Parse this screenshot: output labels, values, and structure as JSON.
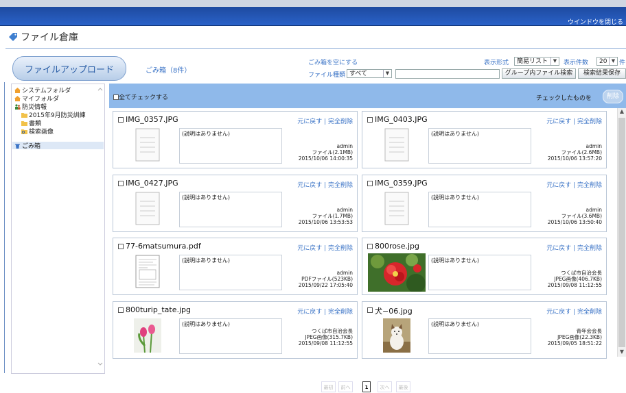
{
  "window": {
    "close_label": "ウインドウを閉じる"
  },
  "header": {
    "title": "ファイル倉庫"
  },
  "toolbar": {
    "upload_label": "ファイルアップロード",
    "trash_label": "ごみ箱（8件）",
    "empty_trash_label": "ごみ箱を空にする",
    "file_type_label": "ファイル種類",
    "file_type_value": "すべて",
    "display_format_label": "表示形式",
    "display_format_value": "簡易リスト",
    "display_count_label": "表示件数",
    "display_count_value": "20",
    "display_count_unit": "件",
    "search_input_value": "",
    "group_search_label": "グループ内ファイル検索",
    "save_results_label": "検索結果保存"
  },
  "sidebar": {
    "items": [
      {
        "label": "システムフォルダ",
        "icon": "home-folder-icon"
      },
      {
        "label": "マイフォルダ",
        "icon": "home-folder-icon"
      },
      {
        "label": "防災情報",
        "icon": "group-icon"
      },
      {
        "label": "2015年9月防災訓練",
        "icon": "folder-icon"
      },
      {
        "label": "書類",
        "icon": "folder-icon"
      },
      {
        "label": "検索画像",
        "icon": "search-folder-icon"
      },
      {
        "label": "ごみ箱",
        "icon": "trash-icon"
      }
    ]
  },
  "checkbar": {
    "check_all_label": "全てチェックする",
    "checked_action_label": "チェックしたものを",
    "delete_label": "削除"
  },
  "actions": {
    "restore": "元に戻す",
    "separator": " | ",
    "delete": "完全削除"
  },
  "files": [
    {
      "name": "IMG_0357.JPG",
      "desc": "(説明はありません)",
      "owner": "admin",
      "type": "ファイル(2.1MB)",
      "date": "2015/10/06 14:00:35",
      "thumb": "document-icon"
    },
    {
      "name": "IMG_0403.JPG",
      "desc": "(説明はありません)",
      "owner": "admin",
      "type": "ファイル(2.6MB)",
      "date": "2015/10/06 13:57:20",
      "thumb": "document-icon"
    },
    {
      "name": "IMG_0427.JPG",
      "desc": "(説明はありません)",
      "owner": "admin",
      "type": "ファイル(1.7MB)",
      "date": "2015/10/06 13:53:53",
      "thumb": "document-icon"
    },
    {
      "name": "IMG_0359.JPG",
      "desc": "(説明はありません)",
      "owner": "admin",
      "type": "ファイル(3.6MB)",
      "date": "2015/10/06 13:50:40",
      "thumb": "document-icon"
    },
    {
      "name": "77-6matsumura.pdf",
      "desc": "(説明はありません)",
      "owner": "admin",
      "type": "PDFファイル(523KB)",
      "date": "2015/09/22 17:05:40",
      "thumb": "pdf-page-icon"
    },
    {
      "name": "800rose.jpg",
      "desc": "(説明はありません)",
      "owner": "つくば市自治会長",
      "type": "JPEG画像(406.7KB)",
      "date": "2015/09/08 11:12:55",
      "thumb": "rose-photo"
    },
    {
      "name": "800turip_tate.jpg",
      "desc": "(説明はありません)",
      "owner": "つくば市自治会長",
      "type": "JPEG画像(315.7KB)",
      "date": "2015/09/08 11:12:55",
      "thumb": "tulip-photo"
    },
    {
      "name": "犬−06.jpg",
      "desc": "(説明はありません)",
      "owner": "青年会会長",
      "type": "JPEG画像(22.3KB)",
      "date": "2015/09/05 18:51:22",
      "thumb": "dog-photo"
    }
  ],
  "pager": {
    "first": "最初",
    "prev": "前へ",
    "current": "1",
    "next": "次へ",
    "last": "最後"
  }
}
